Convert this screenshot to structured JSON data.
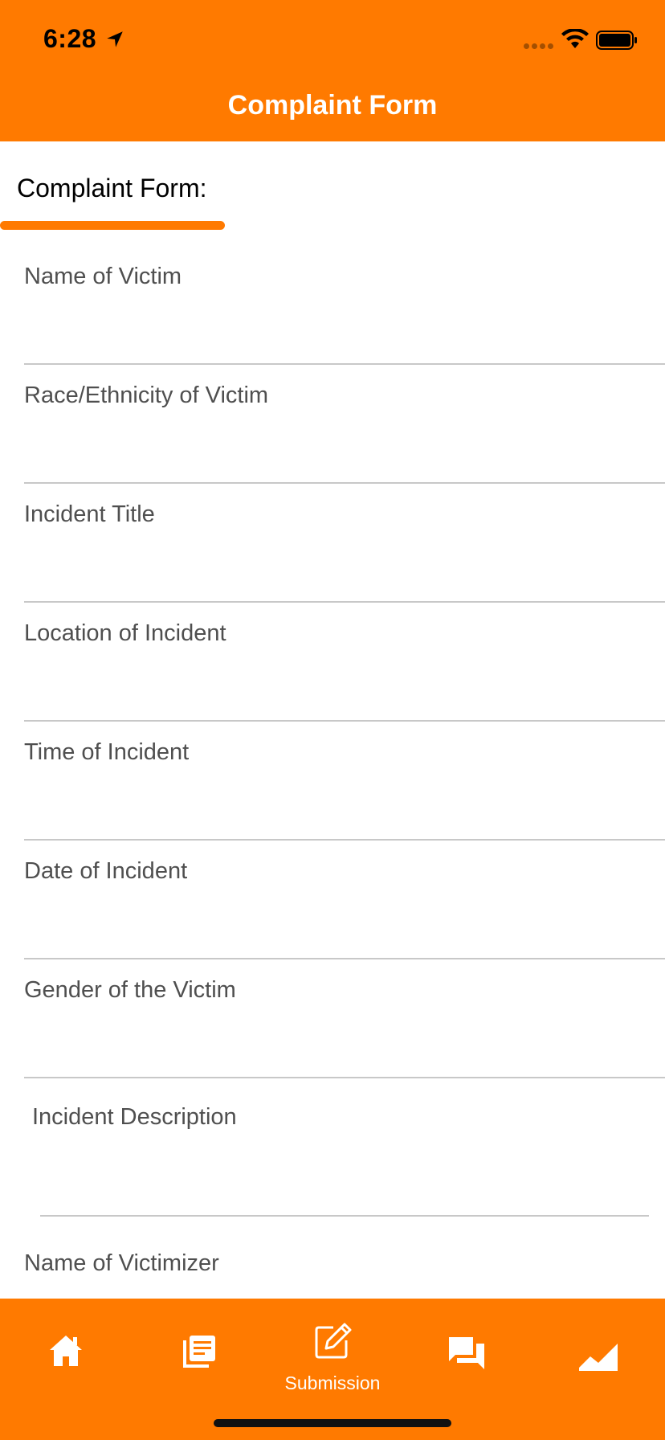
{
  "status": {
    "time": "6:28"
  },
  "nav": {
    "title": "Complaint Form"
  },
  "section": {
    "title": "Complaint Form:"
  },
  "fields": [
    {
      "label": "Name of Victim"
    },
    {
      "label": "Race/Ethnicity of Victim"
    },
    {
      "label": "Incident Title"
    },
    {
      "label": "Location of Incident"
    },
    {
      "label": "Time of Incident"
    },
    {
      "label": "Date of Incident"
    },
    {
      "label": "Gender of the Victim"
    },
    {
      "label": "Incident Description"
    },
    {
      "label": "Name of Victimizer"
    }
  ],
  "tabs": [
    {
      "icon": "home-icon",
      "label": ""
    },
    {
      "icon": "news-icon",
      "label": ""
    },
    {
      "icon": "edit-icon",
      "label": "Submission"
    },
    {
      "icon": "chat-icon",
      "label": ""
    },
    {
      "icon": "chart-icon",
      "label": ""
    }
  ],
  "colors": {
    "accent": "#FF7A00",
    "label": "#4f4f4f",
    "divider": "#c8c8c8"
  }
}
